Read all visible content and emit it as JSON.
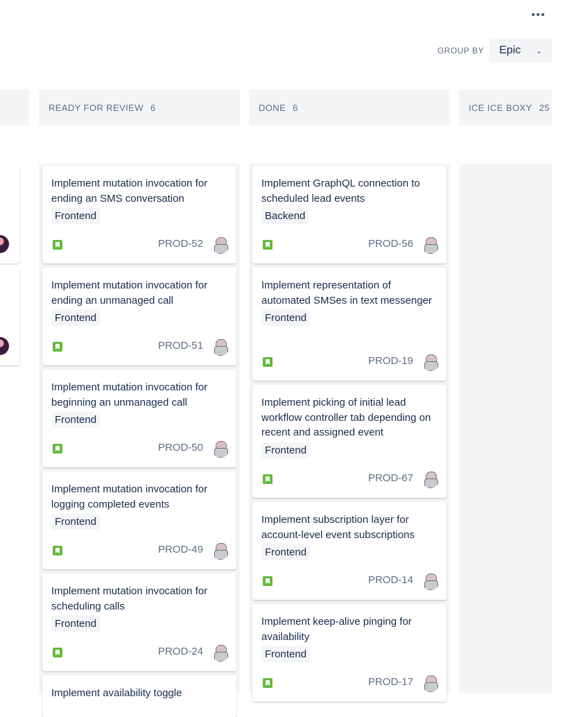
{
  "toolbar": {
    "more_icon": "more-horizontal-icon"
  },
  "group_by": {
    "label": "GROUP BY",
    "value": "Epic"
  },
  "columns": [
    {
      "title": "READY FOR REVIEW",
      "count": "6",
      "cards": [
        {
          "title": "Implement mutation invocation for ending an SMS conversation",
          "epic": "Frontend",
          "key": "PROD-52"
        },
        {
          "title": "Implement mutation invocation for ending an unmanaged call",
          "epic": "Frontend",
          "key": "PROD-51"
        },
        {
          "title": "Implement mutation invocation for beginning an unmanaged call",
          "epic": "Frontend",
          "key": "PROD-50"
        },
        {
          "title": "Implement mutation invocation for logging completed events",
          "epic": "Frontend",
          "key": "PROD-49"
        },
        {
          "title": "Implement mutation invocation for scheduling calls",
          "epic": "Frontend",
          "key": "PROD-24"
        },
        {
          "title": "Implement availability toggle",
          "epic": "",
          "key": ""
        }
      ]
    },
    {
      "title": "DONE",
      "count": "6",
      "cards": [
        {
          "title": "Implement GraphQL connection to scheduled lead events",
          "epic": "Backend",
          "key": "PROD-56"
        },
        {
          "title": "Implement representation of automated SMSes in text messenger",
          "epic": "Frontend",
          "key": "PROD-19"
        },
        {
          "title": "Implement picking of initial lead workflow controller tab depending on recent and assigned event",
          "epic": "Frontend",
          "key": "PROD-67"
        },
        {
          "title": "Implement subscription layer for account-level event subscriptions",
          "epic": "Frontend",
          "key": "PROD-14"
        },
        {
          "title": "Implement keep-alive pinging for availability",
          "epic": "Frontend",
          "key": "PROD-17"
        }
      ]
    },
    {
      "title": "ICE ICE BOXY",
      "count": "25",
      "cards": []
    }
  ],
  "colors": {
    "story_green": "#63ba3c",
    "column_bg": "#f4f5f7",
    "text": "#172b4d",
    "muted": "#5e6c84"
  }
}
